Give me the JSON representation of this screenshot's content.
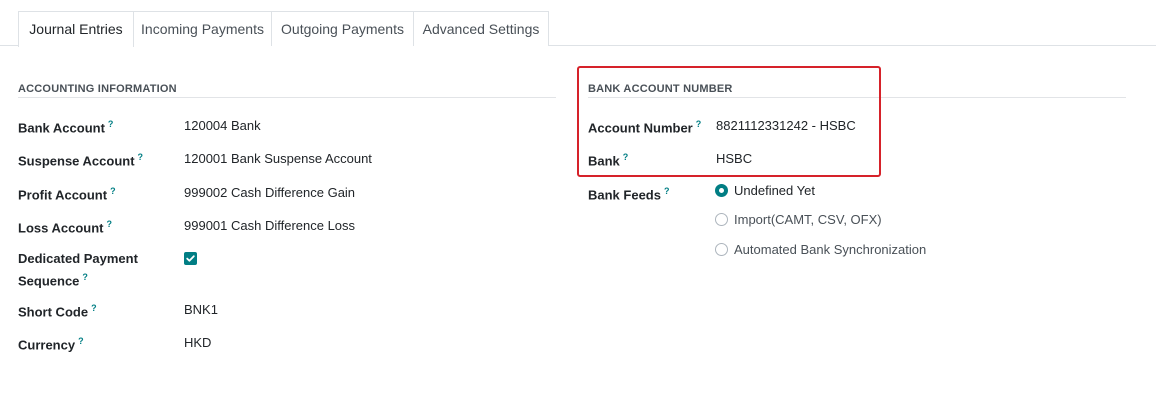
{
  "tabs": [
    {
      "label": "Journal Entries",
      "active": true
    },
    {
      "label": "Incoming Payments",
      "active": false
    },
    {
      "label": "Outgoing Payments",
      "active": false
    },
    {
      "label": "Advanced Settings",
      "active": false
    }
  ],
  "accounting": {
    "title": "ACCOUNTING INFORMATION",
    "help_glyph": "?",
    "bank_account": {
      "label": "Bank Account",
      "value": "120004 Bank"
    },
    "suspense_account": {
      "label": "Suspense Account",
      "value": "120001 Bank Suspense Account"
    },
    "profit_account": {
      "label": "Profit Account",
      "value": "999002 Cash Difference Gain"
    },
    "loss_account": {
      "label": "Loss Account",
      "value": "999001 Cash Difference Loss"
    },
    "dedicated_sequence": {
      "label_line1": "Dedicated Payment",
      "label_line2": "Sequence",
      "checked": true
    },
    "short_code": {
      "label": "Short Code",
      "value": "BNK1"
    },
    "currency": {
      "label": "Currency",
      "value": "HKD"
    }
  },
  "bank_account_number": {
    "title": "BANK ACCOUNT NUMBER",
    "account_number": {
      "label": "Account Number",
      "value": "8821112331242 - HSBC"
    },
    "bank": {
      "label": "Bank",
      "value": "HSBC"
    },
    "bank_feeds": {
      "label": "Bank Feeds",
      "options": [
        {
          "label": "Undefined Yet",
          "checked": true
        },
        {
          "label": "Import(CAMT, CSV, OFX)",
          "checked": false
        },
        {
          "label": "Automated Bank Synchronization",
          "checked": false
        }
      ]
    }
  },
  "colors": {
    "accent": "#017e84",
    "highlight_border": "#d6222a"
  }
}
